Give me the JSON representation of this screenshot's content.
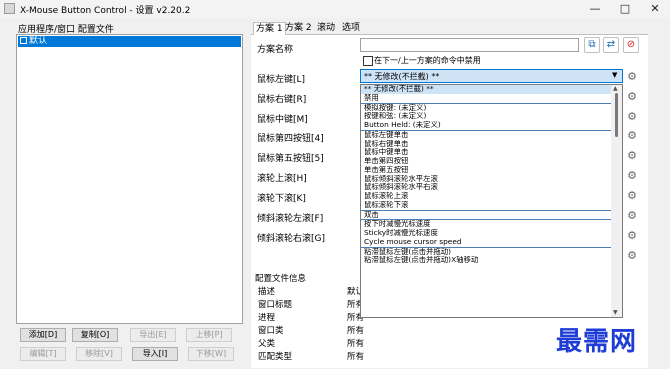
{
  "window": {
    "title": "X-Mouse Button Control - 设置 v2.20.2"
  },
  "left": {
    "label": "应用程序/窗口 配置文件",
    "items": [
      {
        "label": "默认",
        "checked": true
      }
    ],
    "buttons": {
      "add": "添加[D]",
      "copy": "复制[O]",
      "export": "导出[E]",
      "up": "上移[P]",
      "edit": "编辑[T]",
      "remove": "移除[V]",
      "import": "导入[I]",
      "down": "下移[W]"
    }
  },
  "tabs": [
    "方案 1",
    "方案 2",
    "滚动",
    "选项"
  ],
  "profile": {
    "name_label": "方案名称",
    "name_value": "",
    "chain_label": "在下一/上一方案的命令中禁用"
  },
  "buttons": [
    {
      "label": "鼠标左键[L]"
    },
    {
      "label": "鼠标右键[R]"
    },
    {
      "label": "鼠标中键[M]"
    },
    {
      "label": "鼠标第四按钮[4]"
    },
    {
      "label": "鼠标第五按钮[5]"
    },
    {
      "label": "滚轮上滚[H]"
    },
    {
      "label": "滚轮下滚[K]"
    },
    {
      "label": "倾斜滚轮左滚[F]"
    },
    {
      "label": "倾斜滚轮右滚[G]"
    }
  ],
  "combo": {
    "value": "** 无修改(不拦截) **"
  },
  "dropdown": {
    "items": [
      "** 无修改(不拦截) **",
      "禁用",
      "模拟按键: (未定义)",
      "按键和弦: (未定义)",
      "Button Held: (未定义)",
      "鼠标左键单击",
      "鼠标右键单击",
      "鼠标中键单击",
      "单击第四按钮",
      "单击第五按钮",
      "鼠标倾斜滚轮水平左滚",
      "鼠标倾斜滚轮水平右滚",
      "鼠标滚轮上滚",
      "鼠标滚轮下滚",
      "双击",
      "按下时减慢光标速度",
      "Sticky时减慢光标速度",
      "Cycle mouse cursor speed",
      "粘滞鼠标左键(点击并拖动)",
      "粘滞鼠标左键(点击并拖动)X轴移动"
    ]
  },
  "profile_info": {
    "title": "配置文件信息",
    "rows": [
      {
        "key": "描述",
        "value": "默认"
      },
      {
        "key": "窗口标题",
        "value": "所有"
      },
      {
        "key": "进程",
        "value": "所有"
      },
      {
        "key": "窗口类",
        "value": "所有"
      },
      {
        "key": "父类",
        "value": "所有"
      },
      {
        "key": "匹配类型",
        "value": "所有"
      }
    ]
  },
  "watermark": "最需网",
  "colors": {
    "accent": "#0078d7",
    "selection": "#cfe3f7",
    "watermark": "#1e3cd6"
  }
}
